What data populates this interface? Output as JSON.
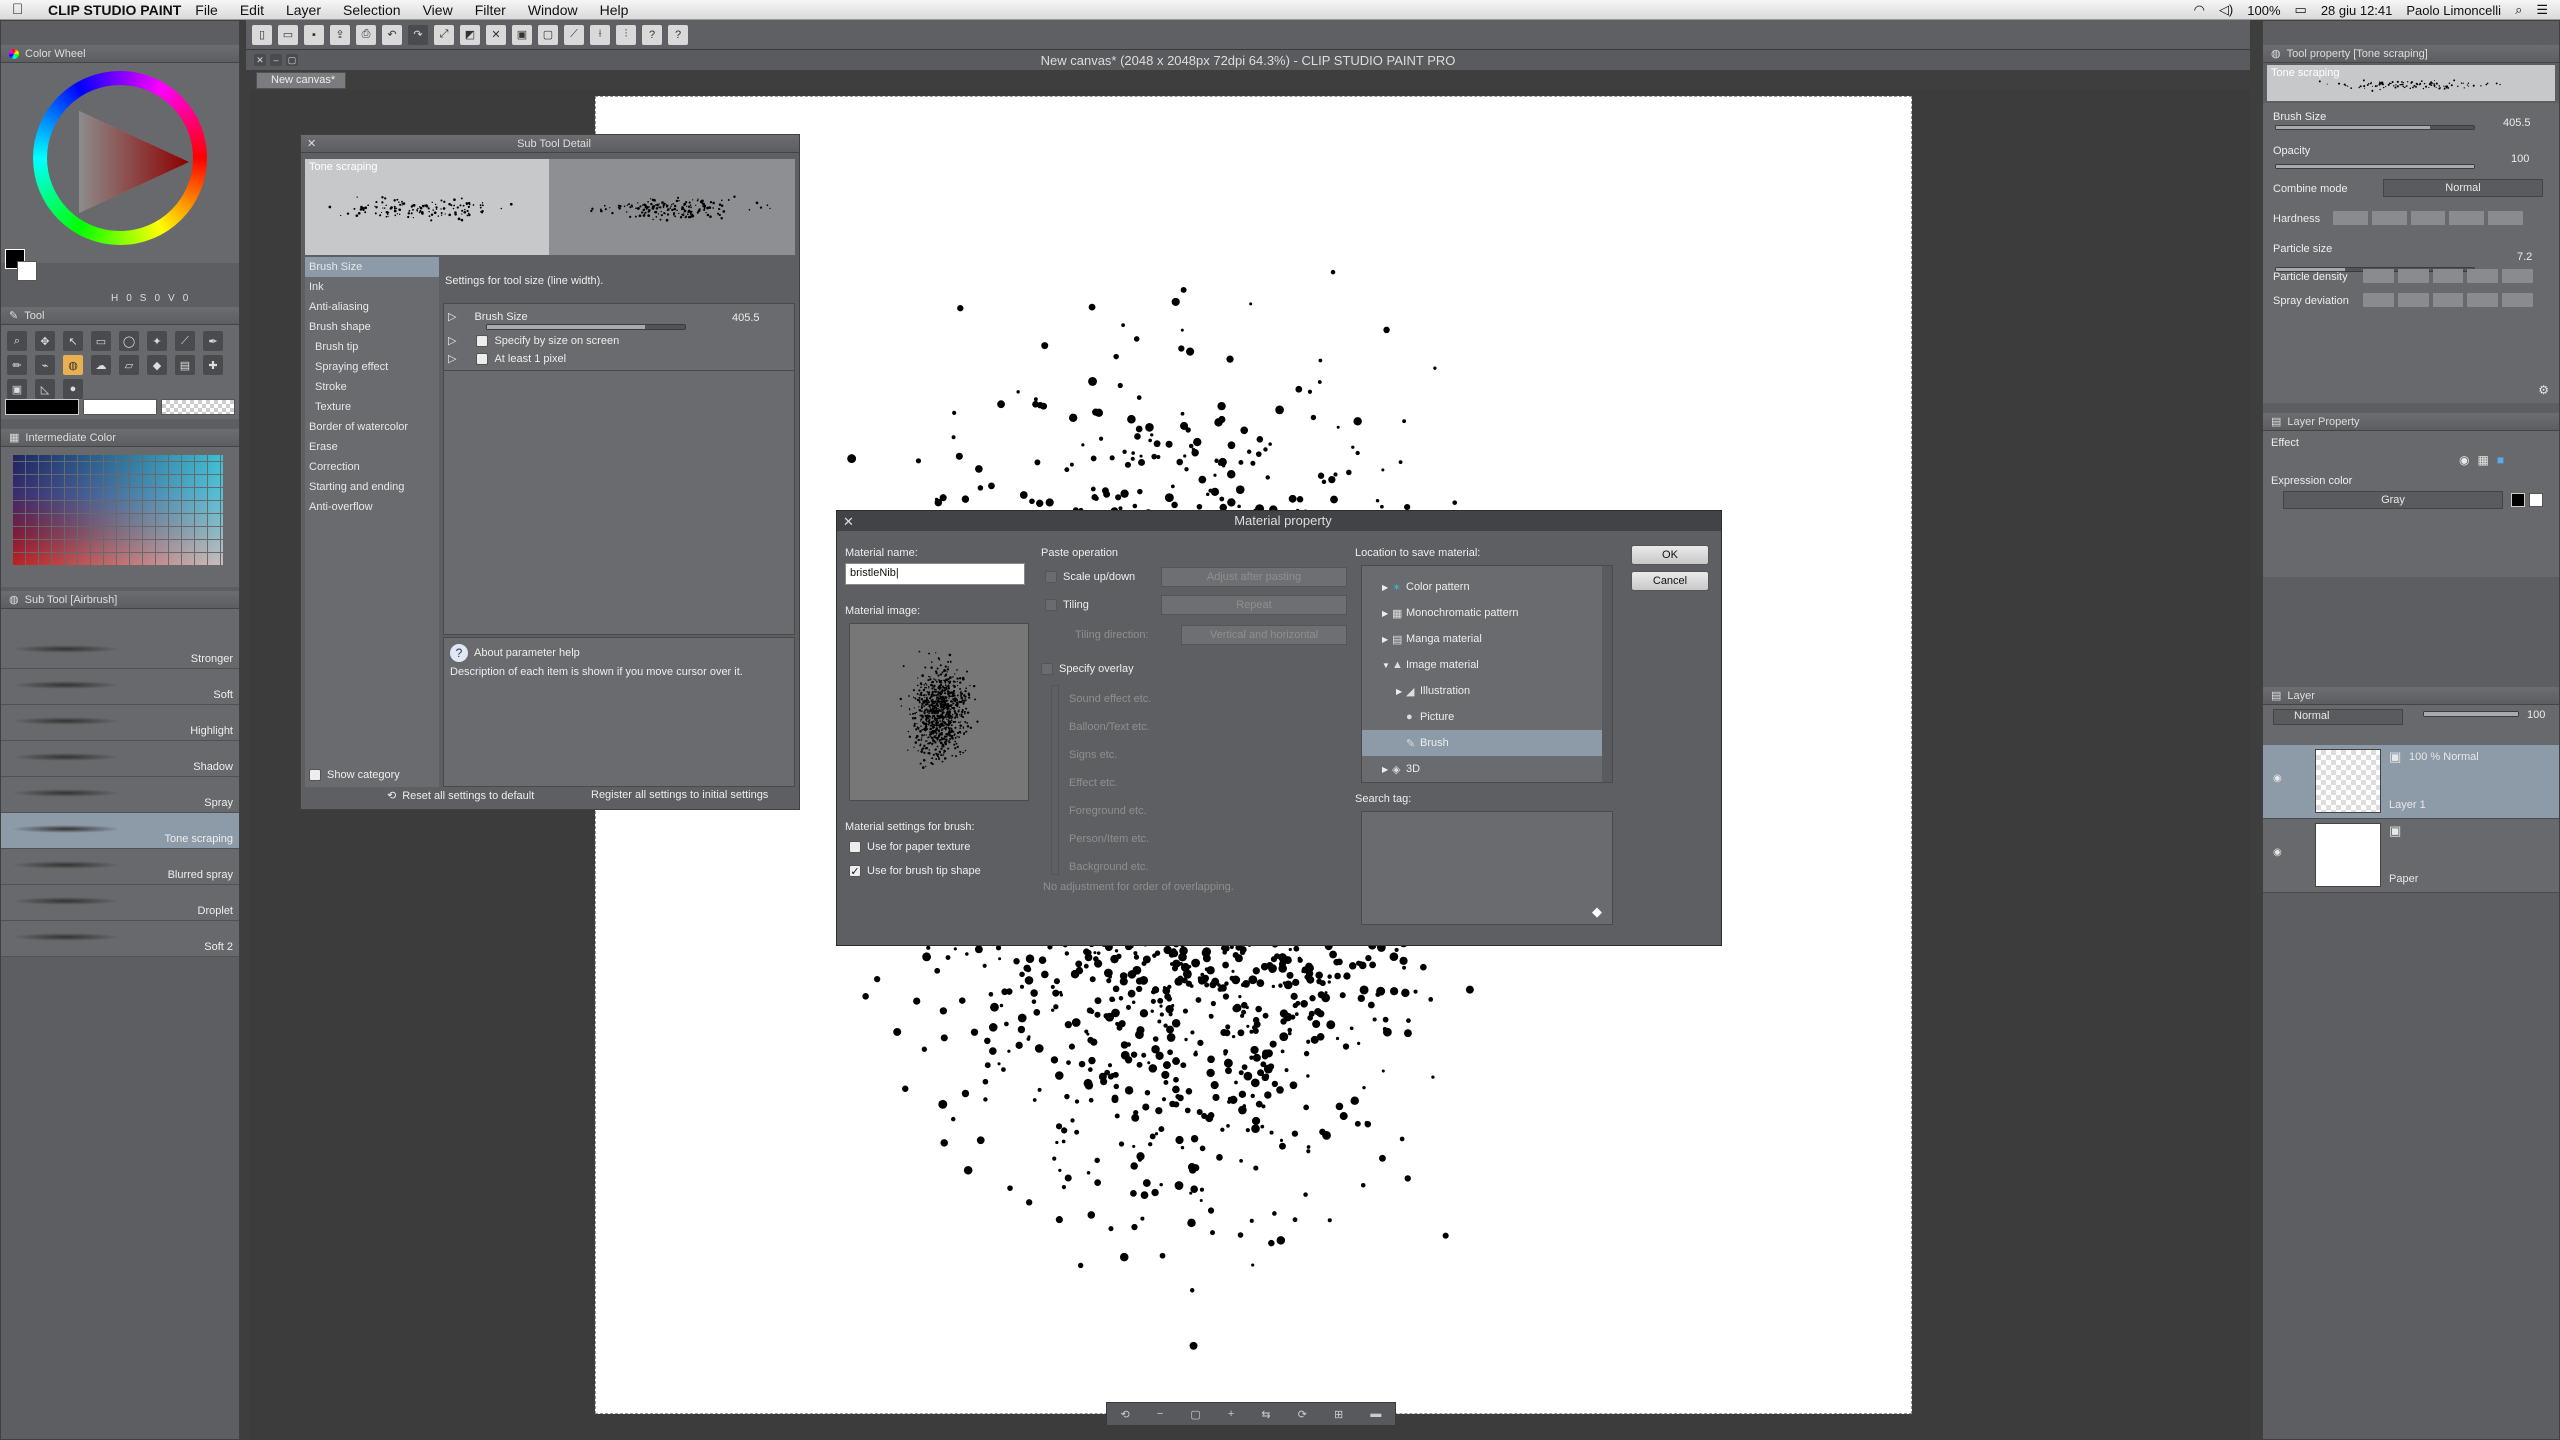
{
  "menubar": {
    "app_name": "CLIP STUDIO PAINT",
    "items": [
      "File",
      "Edit",
      "Layer",
      "Selection",
      "View",
      "Filter",
      "Window",
      "Help"
    ],
    "battery": "100%",
    "date": "28 giu  12:41",
    "user": "Paolo Limoncelli"
  },
  "window": {
    "title": "New canvas* (2048 x 2048px 72dpi 64.3%)  - CLIP STUDIO PAINT PRO",
    "tab": "New canvas*"
  },
  "left": {
    "color_wheel_title": "Color Wheel",
    "color_values": [
      "H",
      "0",
      "S",
      "0",
      "V",
      "0"
    ],
    "tool_title": "Tool",
    "intermediate_title": "Intermediate Color",
    "subtool_title": "Sub Tool [Airbrush]",
    "subtools": [
      "Stronger",
      "Soft",
      "Highlight",
      "Shadow",
      "Spray",
      "Tone scraping",
      "Blurred spray",
      "Droplet",
      "Soft 2"
    ],
    "selected_subtool": "Tone scraping"
  },
  "sub_tool_detail": {
    "title": "Sub Tool Detail",
    "preview_label": "Tone scraping",
    "categories": [
      "Brush Size",
      "Ink",
      "Anti-aliasing",
      "Brush shape",
      "Brush tip",
      "Spraying effect",
      "Stroke",
      "Texture",
      "Border of watercolor",
      "Erase",
      "Correction",
      "Starting and ending",
      "Anti-overflow"
    ],
    "indented": [
      "Brush tip",
      "Spraying effect",
      "Stroke",
      "Texture"
    ],
    "description": "Settings for tool size (line width).",
    "brush_size_label": "Brush Size",
    "brush_size_value": "405.5",
    "brush_size_fill": 0.8,
    "option1": "Specify by size on screen",
    "option2": "At least 1 pixel",
    "help_title": "About parameter help",
    "help_text": "Description of each item is shown if you move cursor over it.",
    "show_category": "Show category",
    "reset_btn": "Reset all settings to default",
    "register_btn": "Register all settings to initial settings"
  },
  "material_dialog": {
    "title": "Material property",
    "name_label": "Material name:",
    "name_value": "bristleNib",
    "image_label": "Material image:",
    "paste_label": "Paste operation",
    "scale_label": "Scale up/down",
    "scale_value": "Adjust after pasting",
    "tiling_label": "Tiling",
    "tiling_value": "Repeat",
    "tiling_dir_label": "Tiling direction:",
    "tiling_dir_value": "Vertical and horizontal",
    "overlay_label": "Specify overlay",
    "overlay_items": [
      "Sound effect etc.",
      "Balloon/Text etc.",
      "Signs etc.",
      "Effect etc.",
      "Foreground etc.",
      "Person/Item etc.",
      "Background etc."
    ],
    "no_adjust": "No adjustment for order of overlapping.",
    "brush_settings_label": "Material settings for brush:",
    "paper_texture": "Use for paper texture",
    "brush_tip": "Use for brush tip shape",
    "location_label": "Location to save material:",
    "tree": [
      {
        "label": "Color pattern",
        "depth": 0,
        "arrow": "▶",
        "icon": "✶"
      },
      {
        "label": "Monochromatic pattern",
        "depth": 0,
        "arrow": "▶",
        "icon": "▦"
      },
      {
        "label": "Manga material",
        "depth": 0,
        "arrow": "▶",
        "icon": "▤"
      },
      {
        "label": "Image material",
        "depth": 0,
        "arrow": "▼",
        "icon": "▲"
      },
      {
        "label": "Illustration",
        "depth": 1,
        "arrow": "▶",
        "icon": "◢"
      },
      {
        "label": "Picture",
        "depth": 1,
        "arrow": "",
        "icon": "●"
      },
      {
        "label": "Brush",
        "depth": 1,
        "arrow": "",
        "icon": "✎"
      },
      {
        "label": "3D",
        "depth": 0,
        "arrow": "▶",
        "icon": "◈"
      }
    ],
    "selected_tree": "Brush",
    "search_tag_label": "Search tag:",
    "ok": "OK",
    "cancel": "Cancel"
  },
  "tool_property": {
    "title": "Tool property [Tone scraping]",
    "preview_label": "Tone scraping",
    "brush_size_label": "Brush Size",
    "brush_size_value": "405.5",
    "brush_size_fill": 0.78,
    "opacity_label": "Opacity",
    "opacity_value": "100",
    "opacity_fill": 1.0,
    "combine_label": "Combine mode",
    "combine_value": "Normal",
    "hardness_label": "Hardness",
    "particle_size_label": "Particle size",
    "particle_size_value": "7.2",
    "particle_size_fill": 0.35,
    "particle_density_label": "Particle density",
    "spray_dev_label": "Spray deviation"
  },
  "layer_property": {
    "title": "Layer Property",
    "effect_label": "Effect",
    "expression_label": "Expression color",
    "expression_value": "Gray"
  },
  "layer_panel": {
    "title": "Layer",
    "blend_value": "Normal",
    "opacity_value": "100",
    "layers": [
      {
        "name": "Layer 1",
        "info": "100 % Normal",
        "selected": true
      },
      {
        "name": "Paper",
        "info": "",
        "selected": false
      }
    ]
  }
}
